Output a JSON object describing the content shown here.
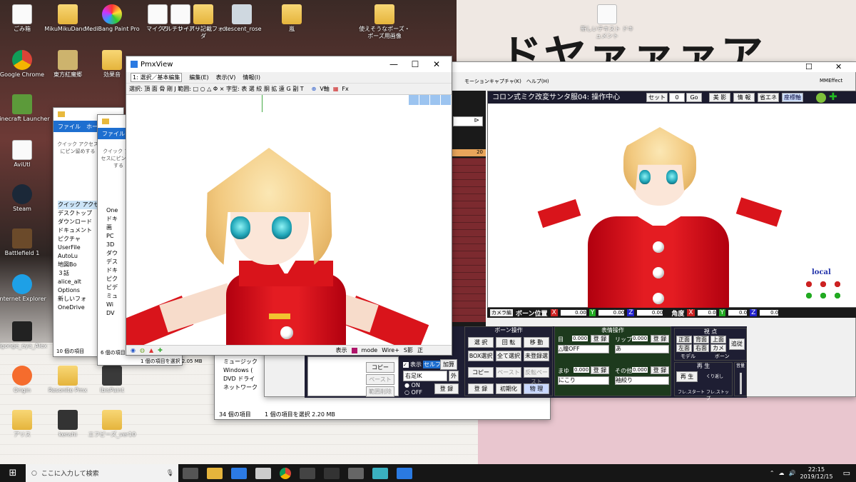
{
  "desktop": {
    "big_text": "ドヤァァァア",
    "icons": [
      {
        "name": "ごみ箱"
      },
      {
        "name": "MikuMikuDanc..."
      },
      {
        "name": "MediBang Paint Pro"
      },
      {
        "name": "マイクラ"
      },
      {
        "name": "マルチサーバー"
      },
      {
        "name": "レイアリ記載フォルダ"
      },
      {
        "name": "crescent_rose"
      },
      {
        "name": "嵐"
      },
      {
        "name": "使えそうなポーズ・ポーズ用画像"
      },
      {
        "name": "新しいテキスト ドキュメント"
      },
      {
        "name": "Google Chrome"
      },
      {
        "name": "東方紅魔郷"
      },
      {
        "name": "効果音"
      },
      {
        "name": "Minecraft Launcher"
      },
      {
        "name": "AviUtl"
      },
      {
        "name": "Steam"
      },
      {
        "name": "Battlefield 1"
      },
      {
        "name": "Internet Explorer"
      },
      {
        "name": "dgonge_eya_Alex"
      },
      {
        "name": "Origin"
      },
      {
        "name": "Resonite Pmx"
      },
      {
        "name": "IbisPaint"
      },
      {
        "name": "アリス"
      },
      {
        "name": "kenshi"
      },
      {
        "name": "エフピーズ_ver10"
      }
    ]
  },
  "explorer1": {
    "tabs": [
      "ファイル",
      "ホーム"
    ],
    "quick": "クイック アクセスにピン留めする",
    "sidebar": [
      "クイック アクセス",
      "デスクトップ",
      "ダウンロード",
      "ドキュメント",
      "ピクチャ",
      "UserFile",
      "AutoLu",
      "地図Bo",
      "３話",
      "alice_alt",
      "Options",
      "新しいフォ",
      "OneDrive"
    ],
    "status": "10 個の項目"
  },
  "explorer2": {
    "tabs": [
      "ファイル"
    ],
    "quick": "クイック アクセスにピン留めする",
    "sidebar": [
      "One",
      "ドキ",
      "画",
      "PC",
      "3D",
      "ダウ",
      "デス",
      "ドキ",
      "ピク",
      "ビデ",
      "ミュ",
      "Wi",
      "DV"
    ],
    "status": "6 個の項目",
    "selection": "1 個の項目を選択 2.05 MB"
  },
  "explorer3": {
    "sidebar": [
      "ミュージック",
      "Windows (",
      "DVD ドライ",
      "ネットワーク"
    ],
    "status": "34 個の項目",
    "selection": "1 個の項目を選択 2.20 MB"
  },
  "pmxview": {
    "title": "PmxView",
    "menu": [
      "1: 選択／基本編集",
      "編集(E)",
      "表示(V)",
      "情報(I)"
    ],
    "toolbar": "選択: 頂 面 骨 剛 J 範囲: □ ○ △ Φ × 字型: 表 選 絞 胴 拡 遠 G 副 T",
    "vaxis": "V軸",
    "fx": "Fx",
    "bottom": {
      "table": "表示",
      "mode": "mode",
      "wire": "Wire+",
      "s": "S影",
      "front": "正"
    }
  },
  "mmd": {
    "menu": "モーションキャプチャ(K)　ヘルプ(H)",
    "mmeffect": "MMEffect",
    "frame_num": "20",
    "viewport_title": "コロン式ミク改変サンタ服04: 操作中心",
    "set_label": "セット",
    "frame_value": "0",
    "go": "Go",
    "beauty": "美 影",
    "info": "情 報",
    "eco": "省エネ",
    "axis": "座標軸",
    "local": "local",
    "camera_tab": "カメラ編",
    "bone_pos": "ボーン位置",
    "angle": "角度",
    "pos": {
      "x": "0.00",
      "y": "0.00",
      "z": "0.00"
    },
    "rot": {
      "x": "0.0",
      "y": "0.0",
      "z": "0.0"
    },
    "bone_panel": {
      "title": "ボーン操作",
      "select": "選 択",
      "rotate": "回 転",
      "move": "移 動",
      "box": "BOX選択",
      "all": "全て選択",
      "unreg": "未登録選",
      "copy": "コピー",
      "paste": "ペースト",
      "rev": "反転ペースト",
      "register": "登 録",
      "init": "初期化",
      "physics": "物 理"
    },
    "morph_panel": {
      "title": "表情操作",
      "eye": "目",
      "lip": "リップ",
      "eyebrow": "まゆ",
      "other": "その他",
      "v1": "0.000",
      "v2": "0.000",
      "v3": "0.000",
      "v4": "0.000",
      "reg": "登 録",
      "eye_sel": "△瞳OFF",
      "lip_sel": "あ",
      "brow_sel": "にこり",
      "other_sel": "袖絞り"
    },
    "view_panel": {
      "title": "視 点",
      "front": "正面",
      "back": "背面",
      "top": "上面",
      "left": "左面",
      "right": "右面",
      "camera": "カメラ",
      "follow": "追従",
      "model": "モデル",
      "bone": "ボーン"
    },
    "play_panel": {
      "title": "再 生",
      "play": "再 生",
      "repeat": "くり返し",
      "frame_start": "フレ.スタート",
      "frame_stop": "フレ.ストップ",
      "volume": "音量"
    },
    "model_panel": {
      "copy": "コピー",
      "paste": "ペースト",
      "delete": "範囲削除",
      "show": "表示",
      "self_shadow": "セルフ影",
      "add": "加算",
      "right": "右足IK",
      "outer": "外",
      "on": "ON",
      "off": "OFF",
      "reg": "登 録"
    }
  },
  "taskbar": {
    "search": "ここに入力して検索",
    "time": "22:15",
    "date": "2019/12/15"
  }
}
